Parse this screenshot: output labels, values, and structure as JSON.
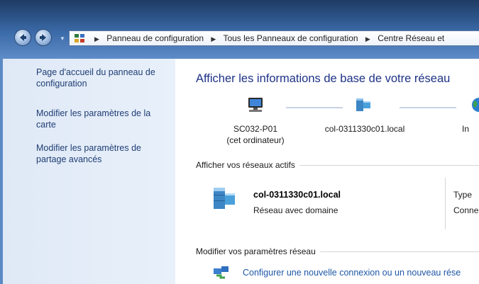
{
  "breadcrumb": {
    "items": [
      "Panneau de configuration",
      "Tous les Panneaux de configuration",
      "Centre Réseau et"
    ]
  },
  "sidebar": {
    "items": [
      {
        "label": "Page d'accueil du panneau de configuration"
      },
      {
        "label": "Modifier les paramètres de la carte"
      },
      {
        "label": "Modifier les paramètres de partage avancés"
      }
    ]
  },
  "main": {
    "title": "Afficher les informations de base de votre réseau",
    "map": {
      "computer_name": "SC032-P01",
      "computer_sub": "(cet ordinateur)",
      "network_name": "col-0311330c01.local",
      "internet_label": "In"
    },
    "active_section": "Afficher vos réseaux actifs",
    "active_network": {
      "name": "col-0311330c01.local",
      "type": "Réseau avec domaine",
      "right_label_1": "Type",
      "right_label_2": "Conne"
    },
    "settings_section": "Modifier vos paramètres réseau",
    "new_connection_link": "Configurer une nouvelle connexion ou un nouveau rése"
  }
}
